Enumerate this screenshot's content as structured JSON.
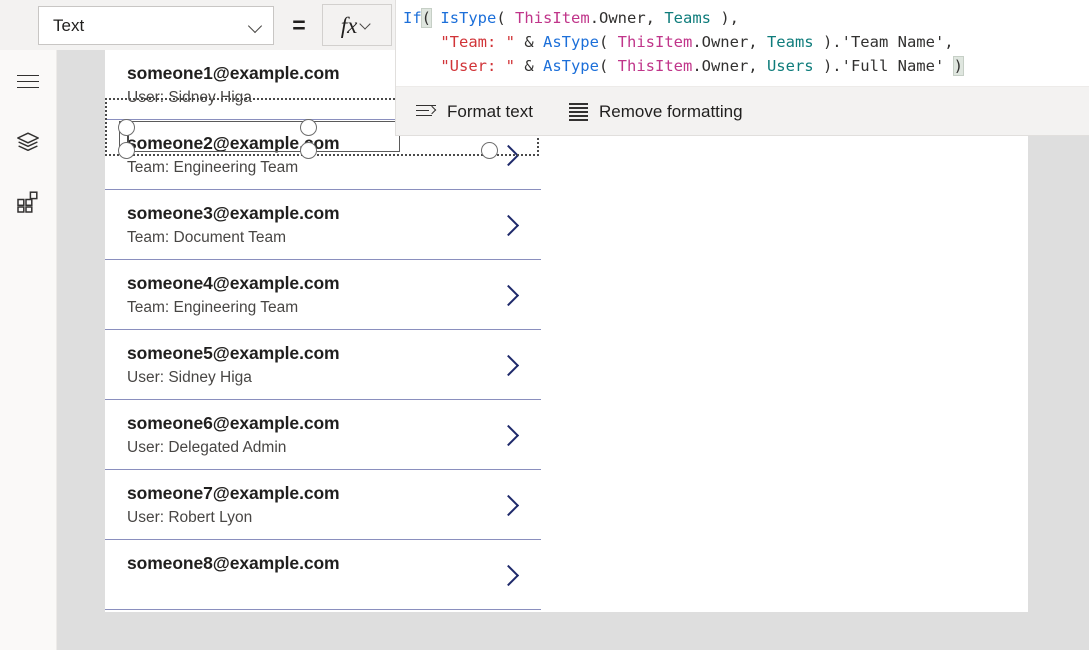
{
  "topbar": {
    "property_dropdown": {
      "value": "Text",
      "icon": "chevron-down-icon"
    },
    "equals_label": "=",
    "fx_button": {
      "glyph": "fx",
      "icon": "chevron-down-icon"
    }
  },
  "formula": {
    "lines": [
      [
        {
          "t": "If",
          "c": "fn"
        },
        {
          "t": "(",
          "c": "paren-hl"
        },
        {
          "t": " ",
          "c": "plain"
        },
        {
          "t": "IsType",
          "c": "fn"
        },
        {
          "t": "( ",
          "c": "plain"
        },
        {
          "t": "ThisItem",
          "c": "var"
        },
        {
          "t": ".Owner, ",
          "c": "plain"
        },
        {
          "t": "Teams",
          "c": "type"
        },
        {
          "t": " ),",
          "c": "plain"
        }
      ],
      [
        {
          "t": "    ",
          "c": "plain"
        },
        {
          "t": "\"Team: \"",
          "c": "str"
        },
        {
          "t": " & ",
          "c": "plain"
        },
        {
          "t": "AsType",
          "c": "fn"
        },
        {
          "t": "( ",
          "c": "plain"
        },
        {
          "t": "ThisItem",
          "c": "var"
        },
        {
          "t": ".Owner, ",
          "c": "plain"
        },
        {
          "t": "Teams",
          "c": "type"
        },
        {
          "t": " ).'Team Name',",
          "c": "plain"
        }
      ],
      [
        {
          "t": "    ",
          "c": "plain"
        },
        {
          "t": "\"User: \"",
          "c": "str"
        },
        {
          "t": " & ",
          "c": "plain"
        },
        {
          "t": "AsType",
          "c": "fn"
        },
        {
          "t": "( ",
          "c": "plain"
        },
        {
          "t": "ThisItem",
          "c": "var"
        },
        {
          "t": ".Owner, ",
          "c": "plain"
        },
        {
          "t": "Users",
          "c": "type"
        },
        {
          "t": " ).'Full Name' ",
          "c": "plain"
        },
        {
          "t": ")",
          "c": "paren-hl"
        }
      ]
    ],
    "toolbar": {
      "format_text_label": "Format text",
      "format_text_icon": "format-text-icon",
      "remove_formatting_label": "Remove formatting",
      "remove_formatting_icon": "remove-formatting-icon"
    }
  },
  "left_rail": {
    "items": [
      {
        "name": "menu",
        "icon": "hamburger-menu-icon"
      },
      {
        "name": "tree-view",
        "icon": "layers-icon"
      },
      {
        "name": "insert",
        "icon": "components-grid-icon"
      }
    ]
  },
  "gallery": {
    "items": [
      {
        "title": "someone1@example.com",
        "subtitle": "User: Sidney Higa",
        "chevron": "chevron-right-icon"
      },
      {
        "title": "someone2@example.com",
        "subtitle": "Team: Engineering Team",
        "chevron": "chevron-right-icon"
      },
      {
        "title": "someone3@example.com",
        "subtitle": "Team: Document Team",
        "chevron": "chevron-right-icon"
      },
      {
        "title": "someone4@example.com",
        "subtitle": "Team: Engineering Team",
        "chevron": "chevron-right-icon"
      },
      {
        "title": "someone5@example.com",
        "subtitle": "User: Sidney Higa",
        "chevron": "chevron-right-icon"
      },
      {
        "title": "someone6@example.com",
        "subtitle": "User: Delegated Admin",
        "chevron": "chevron-right-icon"
      },
      {
        "title": "someone7@example.com",
        "subtitle": "User: Robert Lyon",
        "chevron": "chevron-right-icon"
      },
      {
        "title": "someone8@example.com",
        "subtitle": "",
        "chevron": "chevron-right-icon"
      }
    ]
  },
  "colors": {
    "accent_chevron": "#1f2a6b",
    "row_divider": "#8a8fbe",
    "canvas_bg": "#dedede",
    "chrome_bg": "#f3f2f1",
    "token_function": "#1c6fd9",
    "token_variable": "#c0358a",
    "token_type": "#0e7c7b",
    "token_string": "#d13438"
  }
}
